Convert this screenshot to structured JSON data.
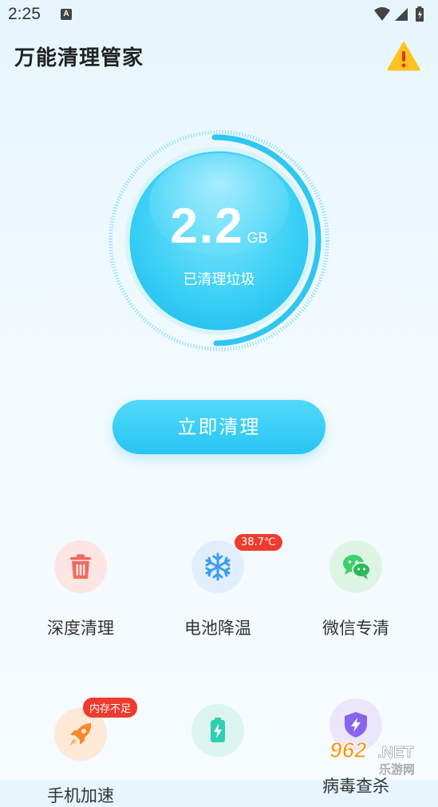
{
  "status_bar": {
    "time": "2:25",
    "notification_letter": "A"
  },
  "header": {
    "title": "万能清理管家",
    "alert_icon": "warning-icon"
  },
  "gauge": {
    "value": "2.2",
    "unit": "GB",
    "label": "已清理垃圾",
    "accent": "#2ec6f3"
  },
  "action": {
    "label": "立即清理"
  },
  "features": [
    {
      "label": "深度清理",
      "icon": "trash-icon",
      "badge": ""
    },
    {
      "label": "电池降温",
      "icon": "snowflake-icon",
      "badge": "38.7℃"
    },
    {
      "label": "微信专清",
      "icon": "wechat-icon",
      "badge": ""
    },
    {
      "label": "手机加速",
      "icon": "rocket-icon",
      "badge": "内存不足"
    },
    {
      "label": "",
      "icon": "battery-icon",
      "badge": ""
    },
    {
      "label": "病毒查杀",
      "icon": "shield-icon",
      "badge": ""
    }
  ],
  "watermark": {
    "brand": "962.NET",
    "sub": "乐游网"
  }
}
